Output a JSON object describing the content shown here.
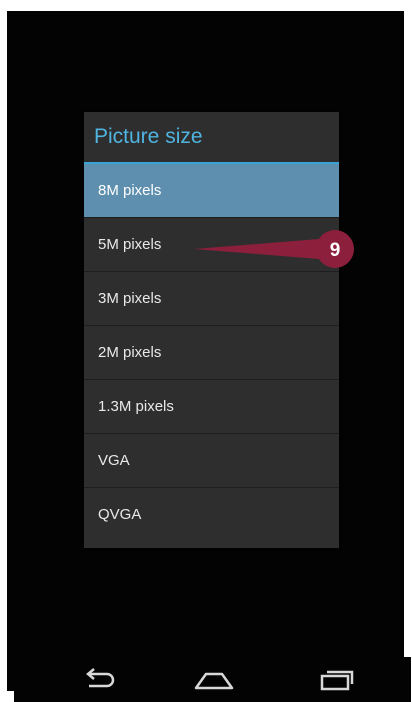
{
  "dialog": {
    "title": "Picture size",
    "options": [
      {
        "label": "8M pixels",
        "selected": true
      },
      {
        "label": "5M pixels",
        "selected": false
      },
      {
        "label": "3M pixels",
        "selected": false
      },
      {
        "label": "2M pixels",
        "selected": false
      },
      {
        "label": "1.3M pixels",
        "selected": false
      },
      {
        "label": "VGA",
        "selected": false
      },
      {
        "label": "QVGA",
        "selected": false
      }
    ]
  },
  "callout": {
    "number": "9",
    "color": "#8c1f3c"
  },
  "navbar": {
    "back_icon": "back-arrow-icon",
    "home_icon": "home-icon",
    "recent_icon": "recent-apps-icon"
  },
  "colors": {
    "selected_bg": "#5e8fae",
    "title_text": "#4fb4e0",
    "dialog_bg": "#2e2e2e"
  }
}
